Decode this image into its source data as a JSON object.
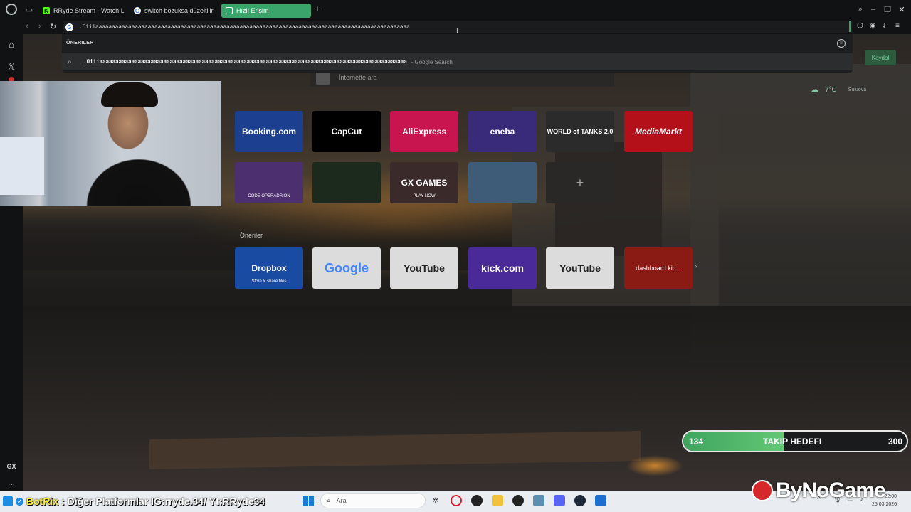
{
  "browser": {
    "tabs": [
      {
        "label": "RRyde Stream - Watch Liv",
        "icon": "kick-icon"
      },
      {
        "label": "switch bozuksa düzeltilir",
        "icon": "google-icon"
      },
      {
        "label": "Hızlı Erişim",
        "icon": "speed-dial-icon",
        "active": true
      }
    ],
    "new_tab": "+",
    "address": ".üiiiaaaaaaaaaaaaaaaaaaaaaaaaaaaaaaaaaaaaaaaaaaaaaaaaaaaaaaaaaaaaaaaaaaaaaaaaaaaaaaaaaaaaaaaaaaaaaaaa"
  },
  "suggestions": {
    "header": "ÖNERILER",
    "row_query": ".üiiiaaaaaaaaaaaaaaaaaaaaaaaaaaaaaaaaaaaaaaaaaaaaaaaaaaaaaaaaaaaaaaaaaaaaaaaaaaaaaaaaaaaaaaaaaaaaaaaa",
    "row_source": "- Google Search"
  },
  "search": {
    "placeholder": "İnternette ara"
  },
  "widgets": {
    "signup": "Kaydol",
    "weather_temp": "7°C",
    "weather_city": "Suluova"
  },
  "speed_dial": [
    {
      "label": "Booking.com",
      "sub": "",
      "color": "#1c3f8f"
    },
    {
      "label": "CapCut",
      "sub": "",
      "color": "#000000"
    },
    {
      "label": "AliExpress",
      "sub": "",
      "color": "#c8154f"
    },
    {
      "label": "eneba",
      "sub": "",
      "color": "#3a2b7a"
    },
    {
      "label": "WORLD of TANKS 2.0",
      "sub": "",
      "color": "#2c2b2b"
    },
    {
      "label": "MediaMarkt",
      "sub": "",
      "color": "#b3101a"
    },
    {
      "label": "",
      "sub": "CODE OPERADRION",
      "color": "#4c2f6e"
    },
    {
      "label": "",
      "sub": "",
      "color": "#1c2a1e"
    },
    {
      "label": "GX GAMES",
      "sub": "PLAY NOW",
      "color": "#3a2a2a"
    },
    {
      "label": "",
      "sub": "",
      "color": "#3e5c77"
    },
    {
      "label": "+",
      "sub": "",
      "color": "#2a2826"
    }
  ],
  "suggested_section": {
    "title": "Öneriler",
    "tiles": [
      {
        "label": "Dropbox",
        "sub": "Store & share files",
        "color": "#1a4ba2"
      },
      {
        "label": "Google",
        "sub": "",
        "color": "#dcdcdc"
      },
      {
        "label": "YouTube",
        "sub": "",
        "color": "#dcdcdc"
      },
      {
        "label": "kick.com",
        "sub": "",
        "color": "#4a2a98"
      },
      {
        "label": "YouTube",
        "sub": "",
        "color": "#dcdcdc"
      },
      {
        "label": "dashboard.kic...",
        "sub": "",
        "color": "#8a1a14"
      }
    ]
  },
  "follow_goal": {
    "current": "134",
    "label": "TAKIP HEDEFI",
    "target": "300",
    "progress": 0.45
  },
  "chat_overlay": {
    "bot_name": "BotRix",
    "message": ": Diğer Platformlar IG:rryde.34/ Yt:RRyde34"
  },
  "taskbar": {
    "search_placeholder": "Ara",
    "time": "22:00",
    "date": "25.03.2026"
  },
  "watermark": "ByNoGame",
  "sidebar": {
    "gx_label": "GX",
    "more": "..."
  }
}
